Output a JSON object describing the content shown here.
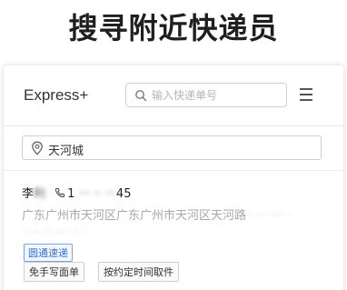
{
  "headline": "搜寻附近快递员",
  "app": {
    "brand": "Express+",
    "search": {
      "placeholder": "输入快递单号",
      "value": ""
    },
    "menu_icon": "hamburger-menu-icon"
  },
  "location": {
    "icon": "location-pin-icon",
    "value": "天河城"
  },
  "courier": {
    "name_visible": "李",
    "name_masked": "利",
    "phone_prefix": "1",
    "phone_masked": "··· ·· ···",
    "phone_suffix": "45",
    "address_visible": "广东广州市天河区广东广州市天河区天河路",
    "address_masked": "·· ·· ···· ·",
    "address_line2_masked": "·· ·· ·· ··· ·· ·",
    "company_tag": "圆通速递",
    "actions": [
      {
        "label": "免手写面单"
      },
      {
        "label": "按约定时间取件"
      }
    ]
  },
  "colors": {
    "tag_blue": "#3a6fd0",
    "muted_text": "#a8a8a8"
  }
}
